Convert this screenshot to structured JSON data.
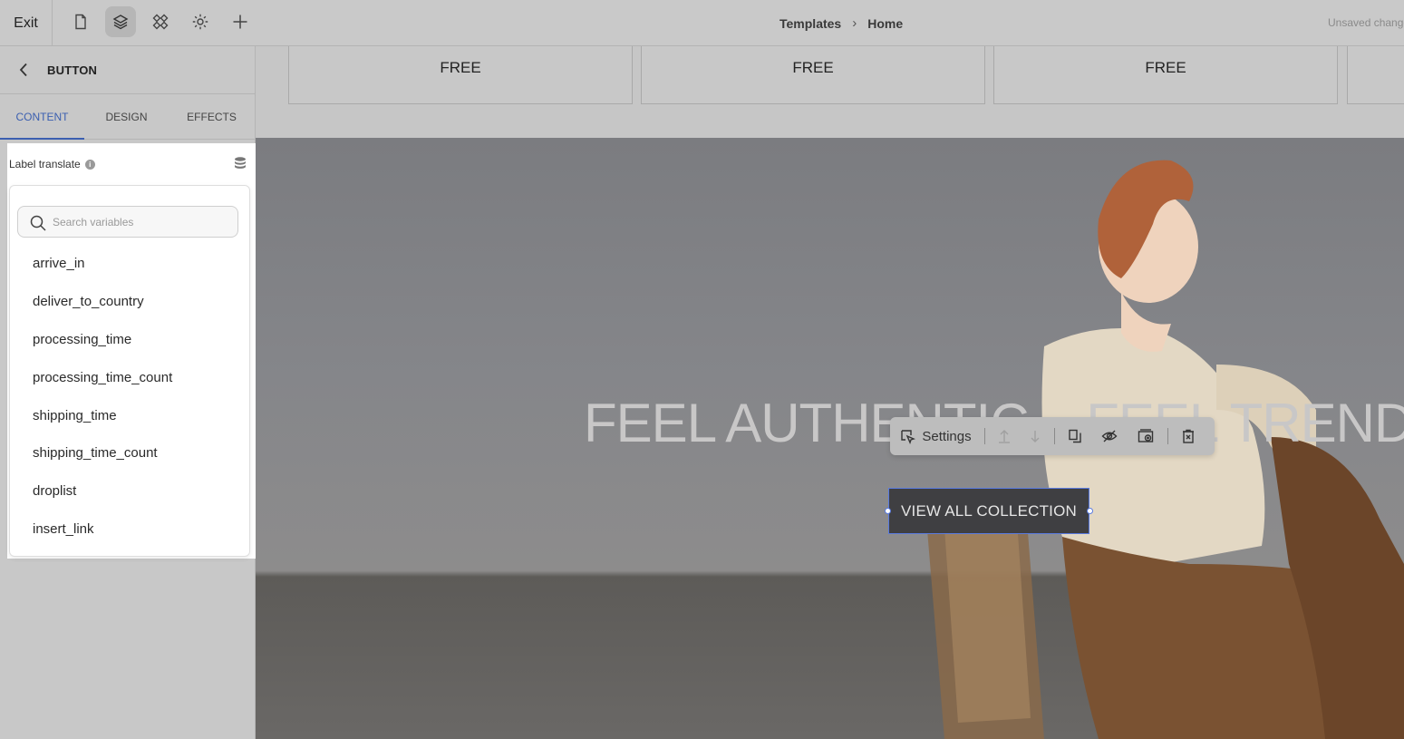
{
  "topbar": {
    "exit_label": "Exit",
    "icons": [
      "page-icon",
      "layers-icon",
      "components-icon",
      "gear-icon",
      "plus-icon"
    ],
    "breadcrumb": [
      "Templates",
      "Home"
    ],
    "status": "Unsaved changes"
  },
  "panel": {
    "title": "BUTTON",
    "tabs": [
      "CONTENT",
      "DESIGN",
      "EFFECTS"
    ],
    "active_tab": "CONTENT",
    "field_label": "Label translate"
  },
  "variables": {
    "search_placeholder": "Search variables",
    "items": [
      "arrive_in",
      "deliver_to_country",
      "processing_time",
      "processing_time_count",
      "shipping_time",
      "shipping_time_count",
      "droplist",
      "insert_link"
    ]
  },
  "canvas": {
    "free_labels": [
      "FREE",
      "FREE",
      "FREE"
    ],
    "hero_title": "FEEL AUTHENTIC – FEEL TRENDY",
    "toolbar": {
      "settings_label": "Settings"
    },
    "cta_label": "VIEW ALL COLLECTION"
  },
  "colors": {
    "accent": "#3b5fb0",
    "selection": "#5a7be0",
    "cta_bg": "#3f3f42"
  }
}
